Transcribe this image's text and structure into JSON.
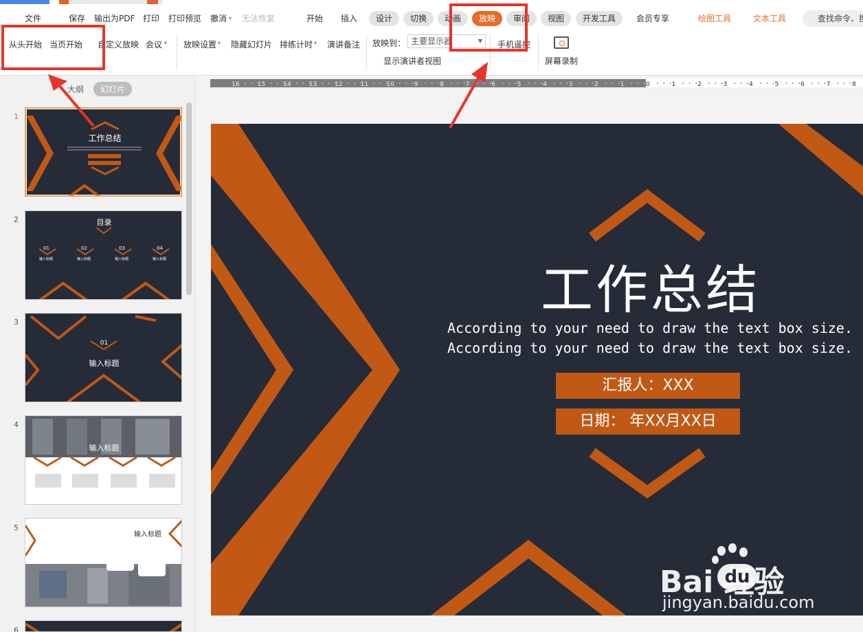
{
  "menu": {
    "file": "文件",
    "save": "保存",
    "export_pdf": "输出为PDF",
    "print": "打印",
    "print_preview": "打印预览",
    "undo": "撤消",
    "redo": "无法恢复"
  },
  "tabs": [
    {
      "label": "开始"
    },
    {
      "label": "插入"
    },
    {
      "label": "设计"
    },
    {
      "label": "切换"
    },
    {
      "label": "动画"
    },
    {
      "label": "放映"
    },
    {
      "label": "审阅"
    },
    {
      "label": "视图"
    },
    {
      "label": "开发工具"
    },
    {
      "label": "会员专享"
    },
    {
      "label": "绘图工具"
    },
    {
      "label": "文本工具"
    }
  ],
  "search": {
    "placeholder": "查找命令、搜"
  },
  "ribbon": {
    "from_start": "从头开始",
    "from_current": "当页开始",
    "custom_show": "自定义放映",
    "meeting": "会议",
    "show_settings": "放映设置",
    "hide_slide": "隐藏幻灯片",
    "rehearse": "排练计时",
    "speaker_notes": "演讲备注",
    "show_to_label": "放映到：",
    "show_to_value": "主要显示器",
    "presenter_view": "显示演讲者视图",
    "phone_remote": "手机遥控",
    "screen_record": "屏幕录制"
  },
  "left_panel": {
    "tab_outline": "大纲",
    "tab_slides": "幻灯片",
    "thumbnails": [
      {
        "num": "1",
        "title": "工作总结"
      },
      {
        "num": "2",
        "title": "目录",
        "items": [
          "01",
          "02",
          "03",
          "04"
        ],
        "item_label": "输入标题"
      },
      {
        "num": "3",
        "title": "输入标题",
        "index": "01"
      },
      {
        "num": "4",
        "title": "输入标题"
      },
      {
        "num": "5",
        "title": "输入标题"
      },
      {
        "num": "6"
      }
    ]
  },
  "ruler": {
    "labels": [
      "16",
      "15",
      "14",
      "13",
      "12",
      "11",
      "10",
      "9",
      "8",
      "7",
      "6",
      "5",
      "4",
      "3",
      "2",
      "1",
      "0",
      "1",
      "2",
      "3",
      "4",
      "5",
      "6",
      "7",
      "8"
    ]
  },
  "slide": {
    "title": "工作总结",
    "subtitle_1": "According to your need to draw the text box size.",
    "subtitle_2": "According to your need to draw the text box size.",
    "reporter": "汇报人：XXX",
    "date": "日期：  年XX月XX日"
  },
  "watermark": {
    "brand": "Bai   经验",
    "du": "du",
    "url": "jingyan.baidu.com"
  },
  "colors": {
    "accent": "#c15915",
    "slide_bg": "#262b38",
    "active_tab": "#e86b2a",
    "annotation": "#e8342a"
  }
}
